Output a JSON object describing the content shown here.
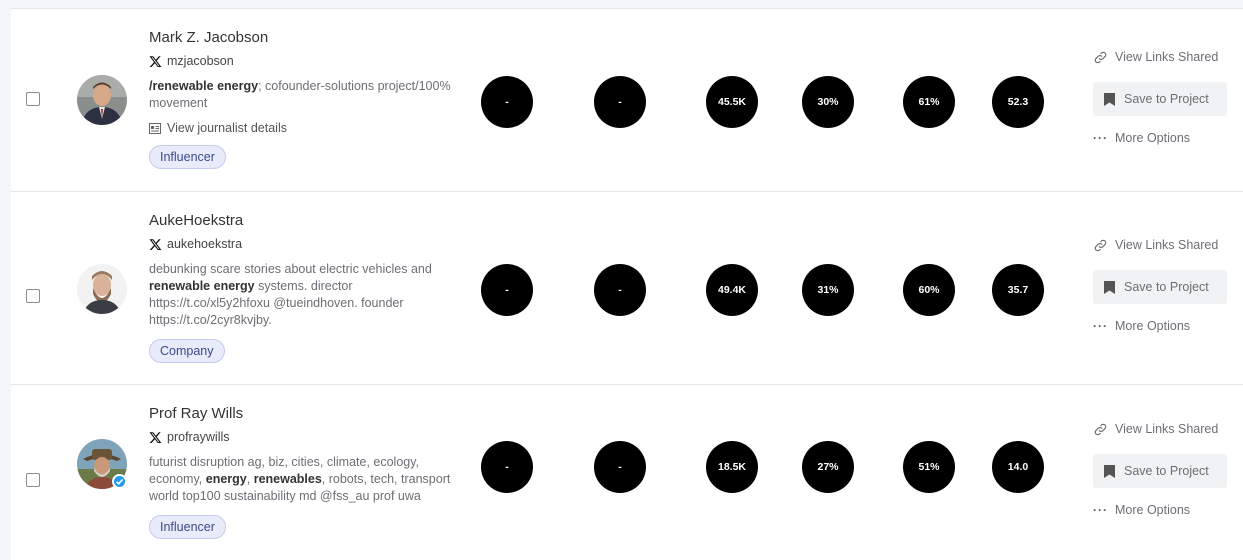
{
  "rows": [
    {
      "name": "Mark Z. Jacobson",
      "handle": "mzjacobson",
      "bio_bold1": "/renewable energy",
      "bio_rest1": "; cofounder-solutions project/100% movement",
      "journalist_link": "View journalist details",
      "tag": "Influencer",
      "metrics": [
        "-",
        "-",
        "45.5K",
        "30%",
        "61%",
        "52.3"
      ]
    },
    {
      "name": "AukeHoekstra",
      "handle": "aukehoekstra",
      "bio_pre": "debunking scare stories about electric vehicles and ",
      "bio_bold1": "renewable energy",
      "bio_rest1": " systems. director https://t.co/xl5y2hfoxu @tueindhoven. founder https://t.co/2cyr8kvjby.",
      "tag": "Company",
      "metrics": [
        "-",
        "-",
        "49.4K",
        "31%",
        "60%",
        "35.7"
      ]
    },
    {
      "name": "Prof Ray Wills",
      "handle": "profraywills",
      "bio_pre": "futurist disruption ag, biz, cities, climate, ecology, economy, ",
      "bio_bold1": "energy",
      "bio_mid": ", ",
      "bio_bold2": "renewables",
      "bio_rest1": ", robots, tech, transport world top100 sustainability md @fss_au prof uwa",
      "tag": "Influencer",
      "metrics": [
        "-",
        "-",
        "18.5K",
        "27%",
        "51%",
        "14.0"
      ]
    }
  ],
  "actions": {
    "view_links": "View Links Shared",
    "save": "Save to Project",
    "more": "More Options"
  },
  "icons": {
    "x": "x-logo-icon",
    "link": "link-icon",
    "bookmark": "bookmark-icon",
    "more": "ellipsis-icon",
    "journalist": "id-card-icon"
  }
}
